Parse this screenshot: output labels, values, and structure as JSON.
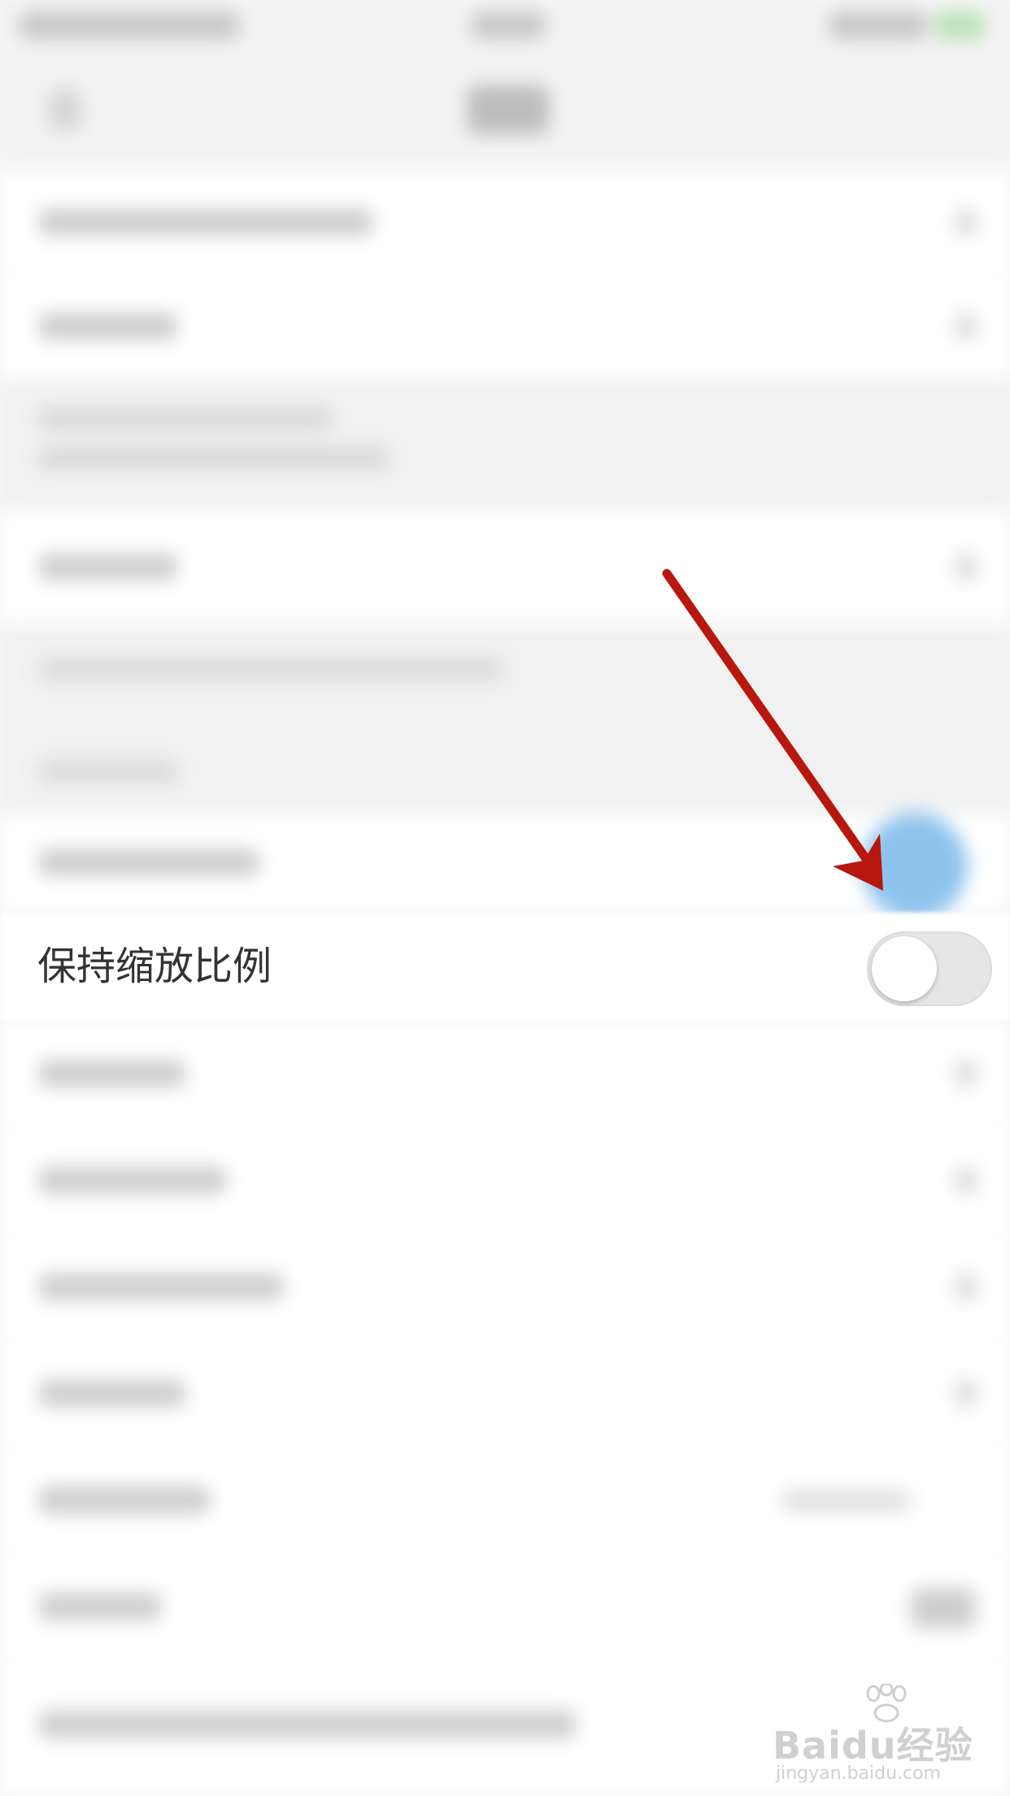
{
  "setting": {
    "label": "保持缩放比例",
    "toggle_on": false
  },
  "watermark": {
    "brand": "Baidu经验",
    "url": "jingyan.baidu.com"
  },
  "annotation": {
    "arrow_color": "#b8170e"
  },
  "colors": {
    "background": "#f6f6f6",
    "row": "#ffffff",
    "toggle_track": "#e6e6e6",
    "highlight_dot": "#8ec3ee"
  }
}
